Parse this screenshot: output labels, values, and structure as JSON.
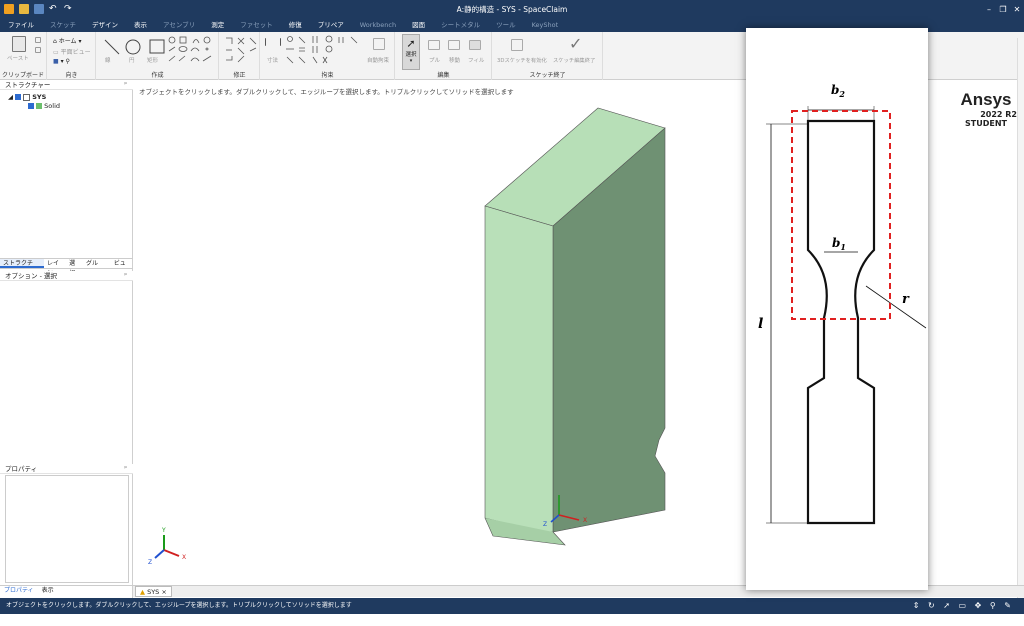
{
  "window": {
    "title": "A:静的構造 - SYS - SpaceClaim",
    "minimize": "–",
    "restore": "❐",
    "close": "✕"
  },
  "menu": [
    {
      "label": "ファイル",
      "dim": false
    },
    {
      "label": "スケッチ",
      "dim": true
    },
    {
      "label": "デザイン",
      "dim": false
    },
    {
      "label": "表示",
      "dim": false
    },
    {
      "label": "アセンブリ",
      "dim": true
    },
    {
      "label": "測定",
      "dim": false
    },
    {
      "label": "ファセット",
      "dim": true
    },
    {
      "label": "修復",
      "dim": false
    },
    {
      "label": "プリペア",
      "dim": false
    },
    {
      "label": "Workbench",
      "dim": true
    },
    {
      "label": "図面",
      "dim": false
    },
    {
      "label": "シートメタル",
      "dim": true
    },
    {
      "label": "ツール",
      "dim": true
    },
    {
      "label": "KeyShot",
      "dim": true
    }
  ],
  "ribbon": {
    "clipboard": {
      "label": "クリップボード",
      "paste": "ペースト"
    },
    "orient": {
      "label": "向き",
      "home": "ホーム",
      "plane_view": "平面ビュー"
    },
    "create": {
      "label": "作成",
      "line": "線",
      "circle": "円",
      "rect": "矩形"
    },
    "modify": {
      "label": "修正"
    },
    "constraint": {
      "label": "拘束",
      "dimension": "寸法",
      "auto": "自動拘束"
    },
    "edit": {
      "label": "編集",
      "select": "選択",
      "pull": "プル",
      "move": "移動",
      "fill": "フィル"
    },
    "sketch_end": {
      "label": "スケッチ終了",
      "enable3d": "3Dスケッチを有効化",
      "end_edit": "スケッチ編集終了"
    }
  },
  "structure": {
    "header": "ストラクチャー",
    "pin": "ᵖ",
    "root": "SYS",
    "child": "Solid"
  },
  "panel_tabs": [
    "ストラクチャ…",
    "レイヤ",
    "選択",
    "グルー…",
    "ビュー"
  ],
  "options": {
    "header": "オプション - 選択",
    "pin": "ᵖ"
  },
  "properties": {
    "header": "プロパティ",
    "pin": "ᵖ"
  },
  "bottom_tabs": [
    "プロパティ",
    "表示"
  ],
  "viewport": {
    "hint": "オブジェクトをクリックします。ダブルクリックして、エッジループを選択します。トリプルクリックしてソリッドを選択します",
    "doc_tab": "SYS",
    "doc_tab_close": "×",
    "triad_x": "X",
    "triad_y": "Y",
    "triad_z": "Z"
  },
  "branding": {
    "name": "Ansys",
    "version": "2022 R2",
    "edition": "STUDENT"
  },
  "overlay_labels": {
    "b2": "b",
    "b2_sub": "2",
    "b1": "b",
    "b1_sub": "1",
    "r": "r",
    "l": "l"
  },
  "status": {
    "text": "オブジェクトをクリックします。ダブルクリックして、エッジループを選択します。トリプルクリックしてソリッドを選択します"
  },
  "colors": {
    "titlebar": "#1f3a5f",
    "solid_front": "#b9e0b9",
    "solid_top": "#b7dfb7",
    "solid_side": "#6f9173",
    "dashed_box": "#e02020"
  }
}
